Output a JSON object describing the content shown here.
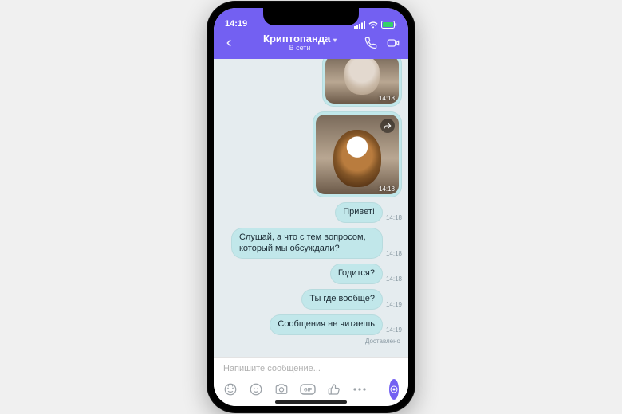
{
  "status": {
    "time": "14:19"
  },
  "header": {
    "title": "Криптопанда",
    "subtitle": "В сети"
  },
  "images": [
    {
      "time": "14:18",
      "alt": "cat-photo-1"
    },
    {
      "time": "14:18",
      "alt": "cat-photo-2"
    }
  ],
  "messages": [
    {
      "text": "Привет!",
      "time": "14:18"
    },
    {
      "text": "Слушай, а что с тем вопросом, который мы обсуждали?",
      "time": "14:18"
    },
    {
      "text": "Годится?",
      "time": "14:18"
    },
    {
      "text": "Ты где вообще?",
      "time": "14:19"
    },
    {
      "text": "Сообщения не читаешь",
      "time": "14:19"
    }
  ],
  "delivered_label": "Доставлено",
  "composer": {
    "placeholder": "Напишите сообщение..."
  }
}
